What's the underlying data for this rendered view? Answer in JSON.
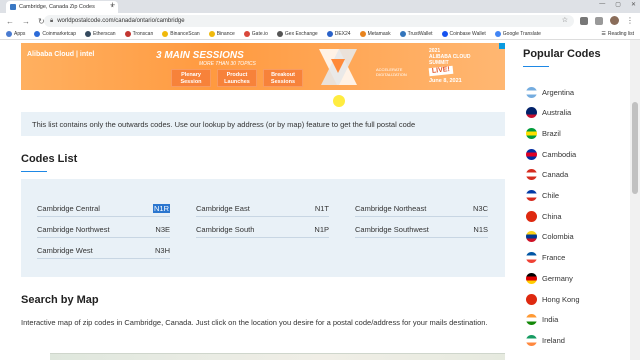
{
  "browser": {
    "tab_title": "Cambridge, Canada Zip Codes",
    "tab_close": "×",
    "new_tab": "+",
    "url": "worldpostalcode.com/canada/ontario/cambridge",
    "back": "←",
    "forward": "→",
    "reload": "↻",
    "star": "☆",
    "bookmarks": [
      {
        "label": "Apps",
        "color": "#4a7bd0"
      },
      {
        "label": "Coinmarketcap",
        "color": "#2c6bd8"
      },
      {
        "label": "Etherscan",
        "color": "#34495e"
      },
      {
        "label": "Tronscan",
        "color": "#c23631"
      },
      {
        "label": "BinanceScan",
        "color": "#f0b90b"
      },
      {
        "label": "Binance",
        "color": "#f0b90b"
      },
      {
        "label": "Gate.io",
        "color": "#d9483b"
      },
      {
        "label": "Gex Exchange",
        "color": "#555555"
      },
      {
        "label": "DEX24",
        "color": "#2a62c9"
      },
      {
        "label": "Metamask",
        "color": "#e8831d"
      },
      {
        "label": "TrustWallet",
        "color": "#3375bb"
      },
      {
        "label": "Coinbase Wallet",
        "color": "#1652f0"
      },
      {
        "label": "Google Translate",
        "color": "#4285f4"
      }
    ],
    "reading_list": "Reading list"
  },
  "ad": {
    "brand": "Alibaba Cloud | intel",
    "headline": "3 MAIN SESSIONS",
    "sub": "MORE THAN 30 TOPICS",
    "chips": [
      "Plenary Session",
      "Product Launches",
      "Breakout Sessions"
    ],
    "accel": "ACCELERATE DIGITALIZATION",
    "summit_line1": "2021",
    "summit_line2": "ALIBABA CLOUD",
    "summit_line3": "SUMMIT",
    "summit_live": "LIVE!",
    "summit_date": "June 8, 2021"
  },
  "notice": "This list contains only the outwards codes. Use our lookup by address (or by map) feature to get the full postal code",
  "codes_title": "Codes List",
  "codes": [
    {
      "name": "Cambridge Central",
      "code": "N1R",
      "highlighted": true
    },
    {
      "name": "Cambridge East",
      "code": "N1T",
      "highlighted": false
    },
    {
      "name": "Cambridge Northeast",
      "code": "N3C",
      "highlighted": false
    },
    {
      "name": "Cambridge Northwest",
      "code": "N3E",
      "highlighted": false
    },
    {
      "name": "Cambridge South",
      "code": "N1P",
      "highlighted": false
    },
    {
      "name": "Cambridge Southwest",
      "code": "N1S",
      "highlighted": false
    },
    {
      "name": "Cambridge West",
      "code": "N3H",
      "highlighted": false
    }
  ],
  "map_title": "Search by Map",
  "map_desc": "Interactive map of zip codes in Cambridge, Canada. Just click on the location you desire for a postal code/address for your mails destination.",
  "sidebar": {
    "title": "Popular Codes",
    "countries": [
      {
        "name": "Argentina",
        "colors": [
          "#74acdf",
          "#ffffff",
          "#74acdf"
        ]
      },
      {
        "name": "Australia",
        "colors": [
          "#012169",
          "#012169",
          "#c8102e"
        ]
      },
      {
        "name": "Brazil",
        "colors": [
          "#009c3b",
          "#ffdf00",
          "#009c3b"
        ]
      },
      {
        "name": "Cambodia",
        "colors": [
          "#032ea1",
          "#e00025",
          "#032ea1"
        ]
      },
      {
        "name": "Canada",
        "colors": [
          "#d52b1e",
          "#ffffff",
          "#d52b1e"
        ]
      },
      {
        "name": "Chile",
        "colors": [
          "#0039a6",
          "#ffffff",
          "#d52b1e"
        ]
      },
      {
        "name": "China",
        "colors": [
          "#de2910",
          "#de2910",
          "#de2910"
        ]
      },
      {
        "name": "Colombia",
        "colors": [
          "#fcd116",
          "#003893",
          "#ce1126"
        ]
      },
      {
        "name": "France",
        "colors": [
          "#0055a4",
          "#ffffff",
          "#ef4135"
        ]
      },
      {
        "name": "Germany",
        "colors": [
          "#000000",
          "#dd0000",
          "#ffce00"
        ]
      },
      {
        "name": "Hong Kong",
        "colors": [
          "#de2910",
          "#de2910",
          "#de2910"
        ]
      },
      {
        "name": "India",
        "colors": [
          "#ff9933",
          "#ffffff",
          "#138808"
        ]
      },
      {
        "name": "Ireland",
        "colors": [
          "#169b62",
          "#ffffff",
          "#ff883e"
        ]
      }
    ]
  }
}
